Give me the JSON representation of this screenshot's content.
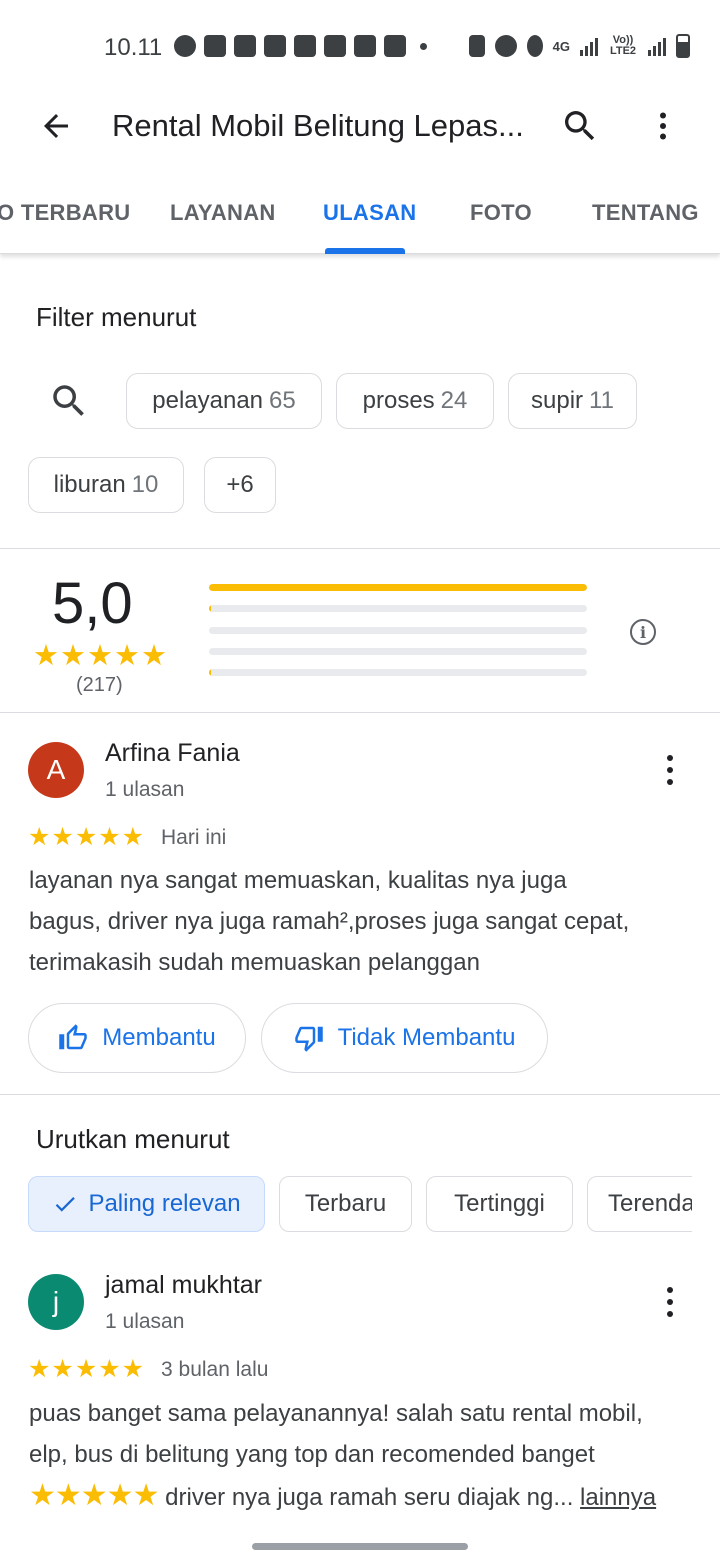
{
  "status_bar": {
    "time": "10.11",
    "network_label": "4G",
    "lte_label": "Vo)) LTE2"
  },
  "app_bar": {
    "title": "Rental Mobil Belitung Lepas...",
    "back_icon": "arrow-back-icon",
    "search_icon": "search-icon",
    "more_icon": "more-vert-icon"
  },
  "tabs": [
    {
      "label": "O TERBARU"
    },
    {
      "label": "LAYANAN"
    },
    {
      "label": "ULASAN",
      "active": true
    },
    {
      "label": "FOTO"
    },
    {
      "label": "TENTANG"
    }
  ],
  "filter": {
    "title": "Filter menurut",
    "chips": [
      {
        "label": "pelayanan",
        "count": "65"
      },
      {
        "label": "proses",
        "count": "24"
      },
      {
        "label": "supir",
        "count": "11"
      },
      {
        "label": "liburan",
        "count": "10"
      },
      {
        "label": "+6"
      }
    ]
  },
  "rating_summary": {
    "score": "5,0",
    "stars": "★★★★★",
    "count": "(217)",
    "distribution": [
      {
        "stars": 5,
        "fraction": 1.0
      },
      {
        "stars": 4,
        "fraction": 0.005
      },
      {
        "stars": 3,
        "fraction": 0.0
      },
      {
        "stars": 2,
        "fraction": 0.0
      },
      {
        "stars": 1,
        "fraction": 0.005
      }
    ]
  },
  "featured_review": {
    "avatar_letter": "A",
    "avatar_color": "#c5391a",
    "name": "Arfina Fania",
    "meta": "1 ulasan",
    "stars": "★★★★★",
    "date": "Hari ini",
    "text_lines": [
      "layanan nya sangat memuaskan, kualitas nya juga",
      "bagus, driver nya juga ramah²,proses juga sangat cepat,",
      "terimakasih sudah memuaskan pelanggan"
    ],
    "helpful_label": "Membantu",
    "not_helpful_label": "Tidak Membantu"
  },
  "sort": {
    "title": "Urutkan menurut",
    "options": [
      {
        "label": "Paling relevan",
        "selected": true
      },
      {
        "label": "Terbaru"
      },
      {
        "label": "Tertinggi"
      },
      {
        "label": "Terendah"
      }
    ]
  },
  "second_review": {
    "avatar_letter": "j",
    "avatar_color": "#0b8a72",
    "name": "jamal mukhtar",
    "meta": "1 ulasan",
    "stars": "★★★★★",
    "date": "3 bulan lalu",
    "text_lines": [
      "puas banget sama pelayanannya! salah satu rental mobil,",
      "elp, bus di belitung yang top dan recomended banget"
    ],
    "emoji_stars": "★★★★★",
    "text_tail": " driver nya juga ramah seru diajak ng...",
    "more_label": "lainnya"
  },
  "colors": {
    "accent": "#1a73e8",
    "star": "#fbbc04"
  }
}
